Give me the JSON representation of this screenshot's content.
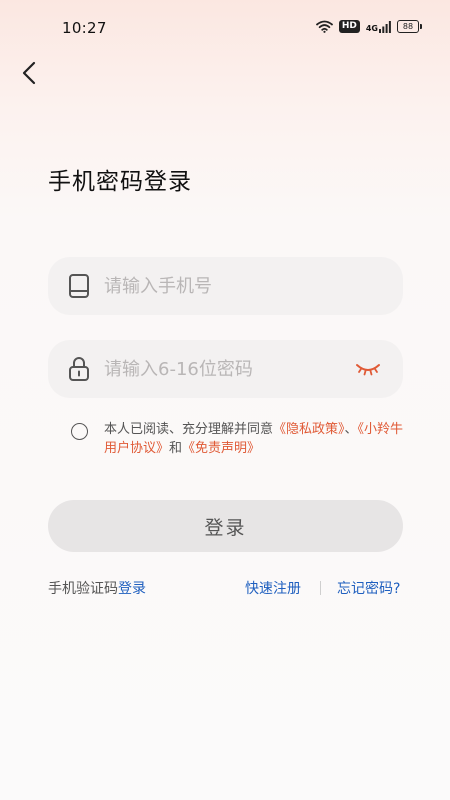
{
  "status_bar": {
    "time": "10:27",
    "hd_label": "HD",
    "network_label": "4G",
    "battery": "88"
  },
  "header": {
    "back_icon": "chevron-left-icon"
  },
  "title": "手机密码登录",
  "phone": {
    "icon": "phone-icon",
    "placeholder": "请输入手机号",
    "value": ""
  },
  "password": {
    "icon": "lock-icon",
    "placeholder": "请输入6-16位密码",
    "value": "",
    "toggle_icon": "eye-closed-icon"
  },
  "agreement": {
    "prefix": "本人已阅读、充分理解并同意",
    "privacy_policy": "《隐私政策》",
    "sep1": "、",
    "user_agreement": "《小羚牛用户协议》",
    "and": "和",
    "disclaimer": "《免责声明》",
    "checked": false
  },
  "login_button": "登录",
  "footer": {
    "sms_prefix": "手机验证码",
    "sms_link": "登录",
    "quick_register": "快速注册",
    "forgot_password": "忘记密码?"
  },
  "colors": {
    "accent_link": "#e05a36",
    "blue_link": "#1f5fbf",
    "field_bg": "#f3f1f1",
    "button_bg": "#e7e5e5"
  }
}
